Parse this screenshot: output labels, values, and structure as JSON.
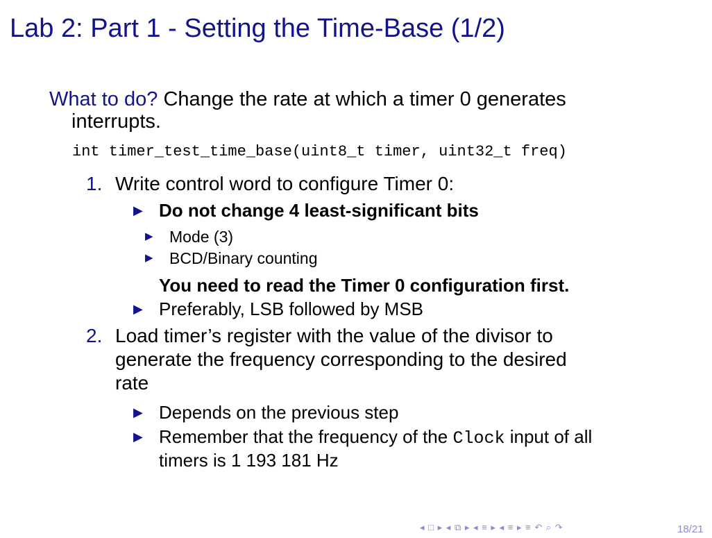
{
  "title": "Lab 2: Part 1 - Setting the Time-Base (1/2)",
  "intro": {
    "label": "What to do?",
    "text_line1": "Change the rate at which a timer 0 generates",
    "text_line2": "interrupts."
  },
  "signature": "int timer_test_time_base(uint8_t timer, uint32_t freq)",
  "steps": [
    {
      "number": "1.",
      "text": "Write control word to configure Timer 0:",
      "bullets": [
        {
          "text": "Do not change 4 least-significant bits",
          "sub_bullets": [
            "Mode (3)",
            "BCD/Binary counting"
          ],
          "note": "You need to read the Timer 0 configuration first."
        },
        {
          "text": "Preferably, LSB followed by MSB"
        }
      ]
    },
    {
      "number": "2.",
      "text_line1": "Load timer’s register with the value of the divisor to",
      "text_line2": "generate the frequency corresponding to the desired",
      "text_line3": "rate",
      "bullets": [
        {
          "text": "Depends on the previous step"
        },
        {
          "text_before": "Remember that the frequency of the",
          "code": "Clock",
          "text_after": "input of all",
          "text_line2": "timers is 1 193 181 Hz"
        }
      ]
    }
  ],
  "footer": {
    "page": "18/21"
  },
  "colors": {
    "accent": "#14148a",
    "nav": "#8a8ad0"
  }
}
